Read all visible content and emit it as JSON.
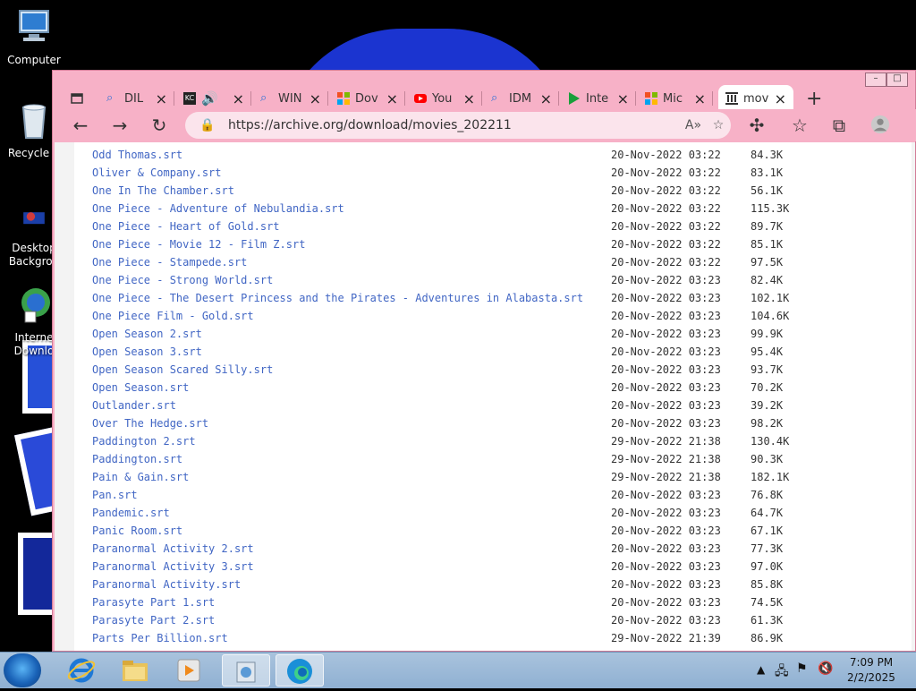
{
  "desktop": {
    "icons": [
      {
        "label": "Computer"
      },
      {
        "label": "Recycle B"
      },
      {
        "label": "Desktop Backgrou"
      },
      {
        "label": "Interne Downlo"
      }
    ]
  },
  "browser": {
    "tabs": [
      {
        "title": "DIL",
        "icon": "search-icon"
      },
      {
        "title": "",
        "icon": "speaker-icon"
      },
      {
        "title": "WIN",
        "icon": "search-icon"
      },
      {
        "title": "Dov",
        "icon": "microsoft-icon"
      },
      {
        "title": "You",
        "icon": "youtube-icon"
      },
      {
        "title": "IDM",
        "icon": "search-icon"
      },
      {
        "title": "Inte",
        "icon": "play-icon"
      },
      {
        "title": "Mic",
        "icon": "microsoft-icon"
      },
      {
        "title": "mov",
        "icon": "archive-icon"
      }
    ],
    "url": "https://archive.org/download/movies_202211"
  },
  "files": [
    {
      "name": "Odd Thomas.srt",
      "date": "20-Nov-2022 03:22",
      "size": "84.3K"
    },
    {
      "name": "Oliver & Company.srt",
      "date": "20-Nov-2022 03:22",
      "size": "83.1K"
    },
    {
      "name": "One In The Chamber.srt",
      "date": "20-Nov-2022 03:22",
      "size": "56.1K"
    },
    {
      "name": "One Piece - Adventure of Nebulandia.srt",
      "date": "20-Nov-2022 03:22",
      "size": "115.3K"
    },
    {
      "name": "One Piece - Heart of Gold.srt",
      "date": "20-Nov-2022 03:22",
      "size": "89.7K"
    },
    {
      "name": "One Piece - Movie 12 - Film Z.srt",
      "date": "20-Nov-2022 03:22",
      "size": "85.1K"
    },
    {
      "name": "One Piece - Stampede.srt",
      "date": "20-Nov-2022 03:22",
      "size": "97.5K"
    },
    {
      "name": "One Piece - Strong World.srt",
      "date": "20-Nov-2022 03:23",
      "size": "82.4K"
    },
    {
      "name": "One Piece - The Desert Princess and the Pirates - Adventures in Alabasta.srt",
      "date": "20-Nov-2022 03:23",
      "size": "102.1K"
    },
    {
      "name": "One Piece Film - Gold.srt",
      "date": "20-Nov-2022 03:23",
      "size": "104.6K"
    },
    {
      "name": "Open Season 2.srt",
      "date": "20-Nov-2022 03:23",
      "size": "99.9K"
    },
    {
      "name": "Open Season 3.srt",
      "date": "20-Nov-2022 03:23",
      "size": "95.4K"
    },
    {
      "name": "Open Season Scared Silly.srt",
      "date": "20-Nov-2022 03:23",
      "size": "93.7K"
    },
    {
      "name": "Open Season.srt",
      "date": "20-Nov-2022 03:23",
      "size": "70.2K"
    },
    {
      "name": "Outlander.srt",
      "date": "20-Nov-2022 03:23",
      "size": "39.2K"
    },
    {
      "name": "Over The Hedge.srt",
      "date": "20-Nov-2022 03:23",
      "size": "98.2K"
    },
    {
      "name": "Paddington 2.srt",
      "date": "29-Nov-2022 21:38",
      "size": "130.4K"
    },
    {
      "name": "Paddington.srt",
      "date": "29-Nov-2022 21:38",
      "size": "90.3K"
    },
    {
      "name": "Pain & Gain.srt",
      "date": "29-Nov-2022 21:38",
      "size": "182.1K"
    },
    {
      "name": "Pan.srt",
      "date": "20-Nov-2022 03:23",
      "size": "76.8K"
    },
    {
      "name": "Pandemic.srt",
      "date": "20-Nov-2022 03:23",
      "size": "64.7K"
    },
    {
      "name": "Panic Room.srt",
      "date": "20-Nov-2022 03:23",
      "size": "67.1K"
    },
    {
      "name": "Paranormal Activity 2.srt",
      "date": "20-Nov-2022 03:23",
      "size": "77.3K"
    },
    {
      "name": "Paranormal Activity 3.srt",
      "date": "20-Nov-2022 03:23",
      "size": "97.0K"
    },
    {
      "name": "Paranormal Activity.srt",
      "date": "20-Nov-2022 03:23",
      "size": "85.8K"
    },
    {
      "name": "Parasyte Part 1.srt",
      "date": "20-Nov-2022 03:23",
      "size": "74.5K"
    },
    {
      "name": "Parasyte Part 2.srt",
      "date": "20-Nov-2022 03:23",
      "size": "61.3K"
    },
    {
      "name": "Parts Per Billion.srt",
      "date": "29-Nov-2022 21:39",
      "size": "86.9K"
    }
  ],
  "taskbar": {
    "time": "7:09 PM",
    "date": "2/2/2025"
  },
  "colors": {
    "window_frame": "#f7b1c7",
    "link": "#4166c4",
    "taskbar": "#a9c3dd"
  }
}
